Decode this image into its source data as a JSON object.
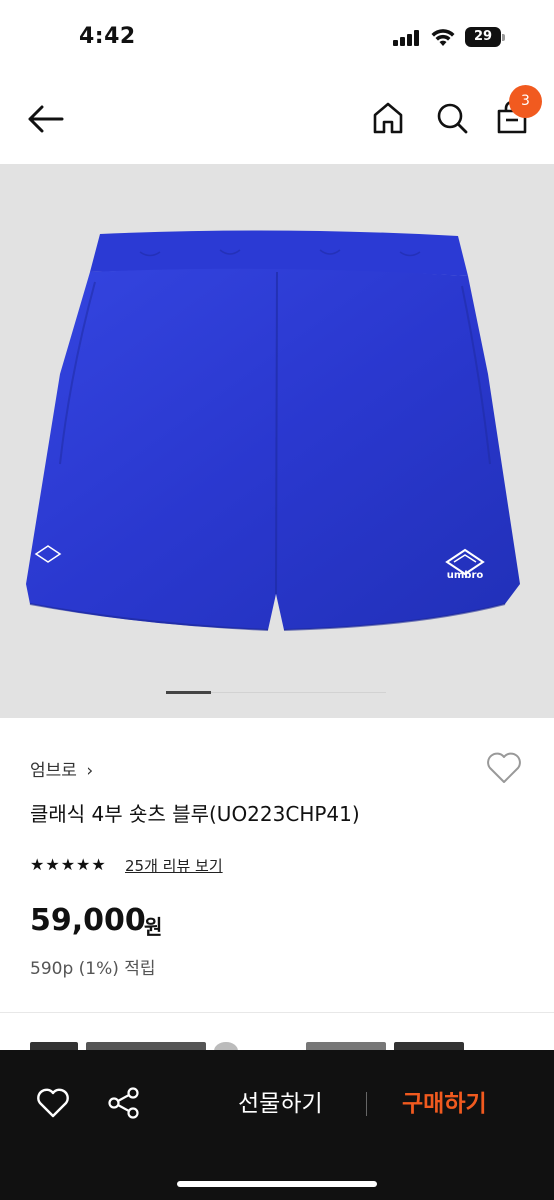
{
  "status_bar": {
    "time": "4:42",
    "battery": "29"
  },
  "header": {
    "back_icon": "arrow-left-icon",
    "home_icon": "home-icon",
    "search_icon": "search-icon",
    "cart_icon": "shopping-bag-icon",
    "cart_badge": "3",
    "badge_color": "#f15a1f"
  },
  "gallery": {
    "background": "#e2e2e2",
    "product_color": "#2b3bd0",
    "logo_text": "umbro"
  },
  "product": {
    "brand": "엄브로",
    "brand_arrow": "›",
    "name": "클래식 4부 숏츠 블루(UO223CHP41)",
    "rating_icon": "star-icon",
    "review_link": "25개 리뷰 보기",
    "price": "59,000",
    "price_unit": "원",
    "points": "590p (1%) 적립"
  },
  "bottom_bar": {
    "wish_icon": "heart-icon",
    "share_icon": "share-icon",
    "gift_label": "선물하기",
    "buy_label": "구매하기",
    "accent": "#f15a1f"
  }
}
